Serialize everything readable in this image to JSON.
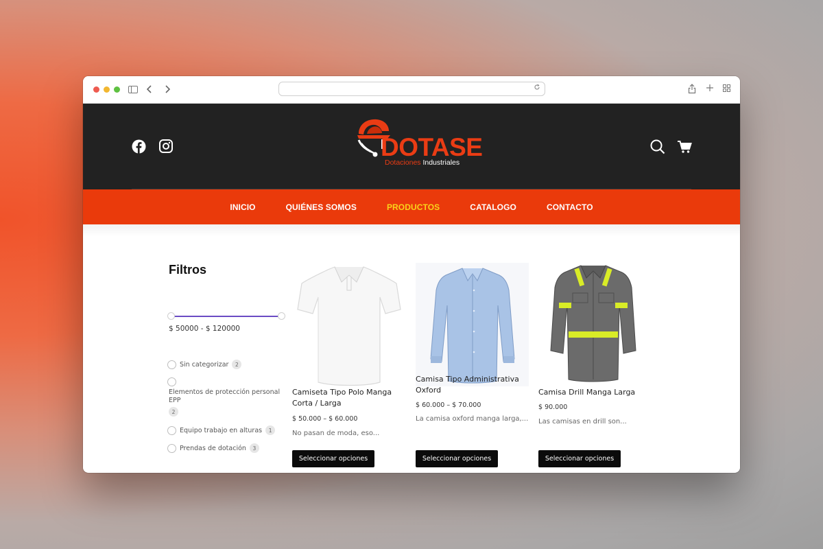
{
  "browser": {
    "url": ""
  },
  "header": {
    "logo_word": "DOTASE",
    "logo_sub_1": "Dotaciones",
    "logo_sub_2": "Industriales",
    "social": [
      "facebook-icon",
      "instagram-icon"
    ],
    "actions": [
      "search-icon",
      "cart-icon"
    ]
  },
  "nav": {
    "items": [
      {
        "label": "INICIO"
      },
      {
        "label": "QUIÉNES SOMOS"
      },
      {
        "label": "PRODUCTOS"
      },
      {
        "label": "CATALOGO"
      },
      {
        "label": "CONTACTO"
      }
    ],
    "active_index": 2
  },
  "filters": {
    "title": "Filtros",
    "price_range": "$ 50000 - $ 120000",
    "categories": [
      {
        "label": "Sin categorizar",
        "count": "2"
      },
      {
        "label": "Elementos de protección personal EPP",
        "count": "2"
      },
      {
        "label": "Equipo trabajo en alturas",
        "count": "1"
      },
      {
        "label": "Prendas de dotación",
        "count": "3"
      }
    ]
  },
  "products": [
    {
      "name_1": "Camiseta Tipo Polo Manga",
      "name_2": "Corta / Larga",
      "price": "$ 50.000 – $ 60.000",
      "desc": "No pasan de moda, eso...",
      "button": "Seleccionar opciones"
    },
    {
      "name_1": "Camisa Tipo Administrativa",
      "name_2": "Oxford",
      "price": "$ 60.000 – $ 70.000",
      "desc": "La camisa oxford manga larga,...",
      "button": "Seleccionar opciones"
    },
    {
      "name_1": "Camisa Drill Manga Larga",
      "price": "$ 90.000",
      "desc": "Las camisas en drill son...",
      "button": "Seleccionar opciones"
    }
  ],
  "colors": {
    "brand_orange": "#ea3a0b",
    "active_nav": "#f9d31a",
    "header_dark": "#222222"
  }
}
